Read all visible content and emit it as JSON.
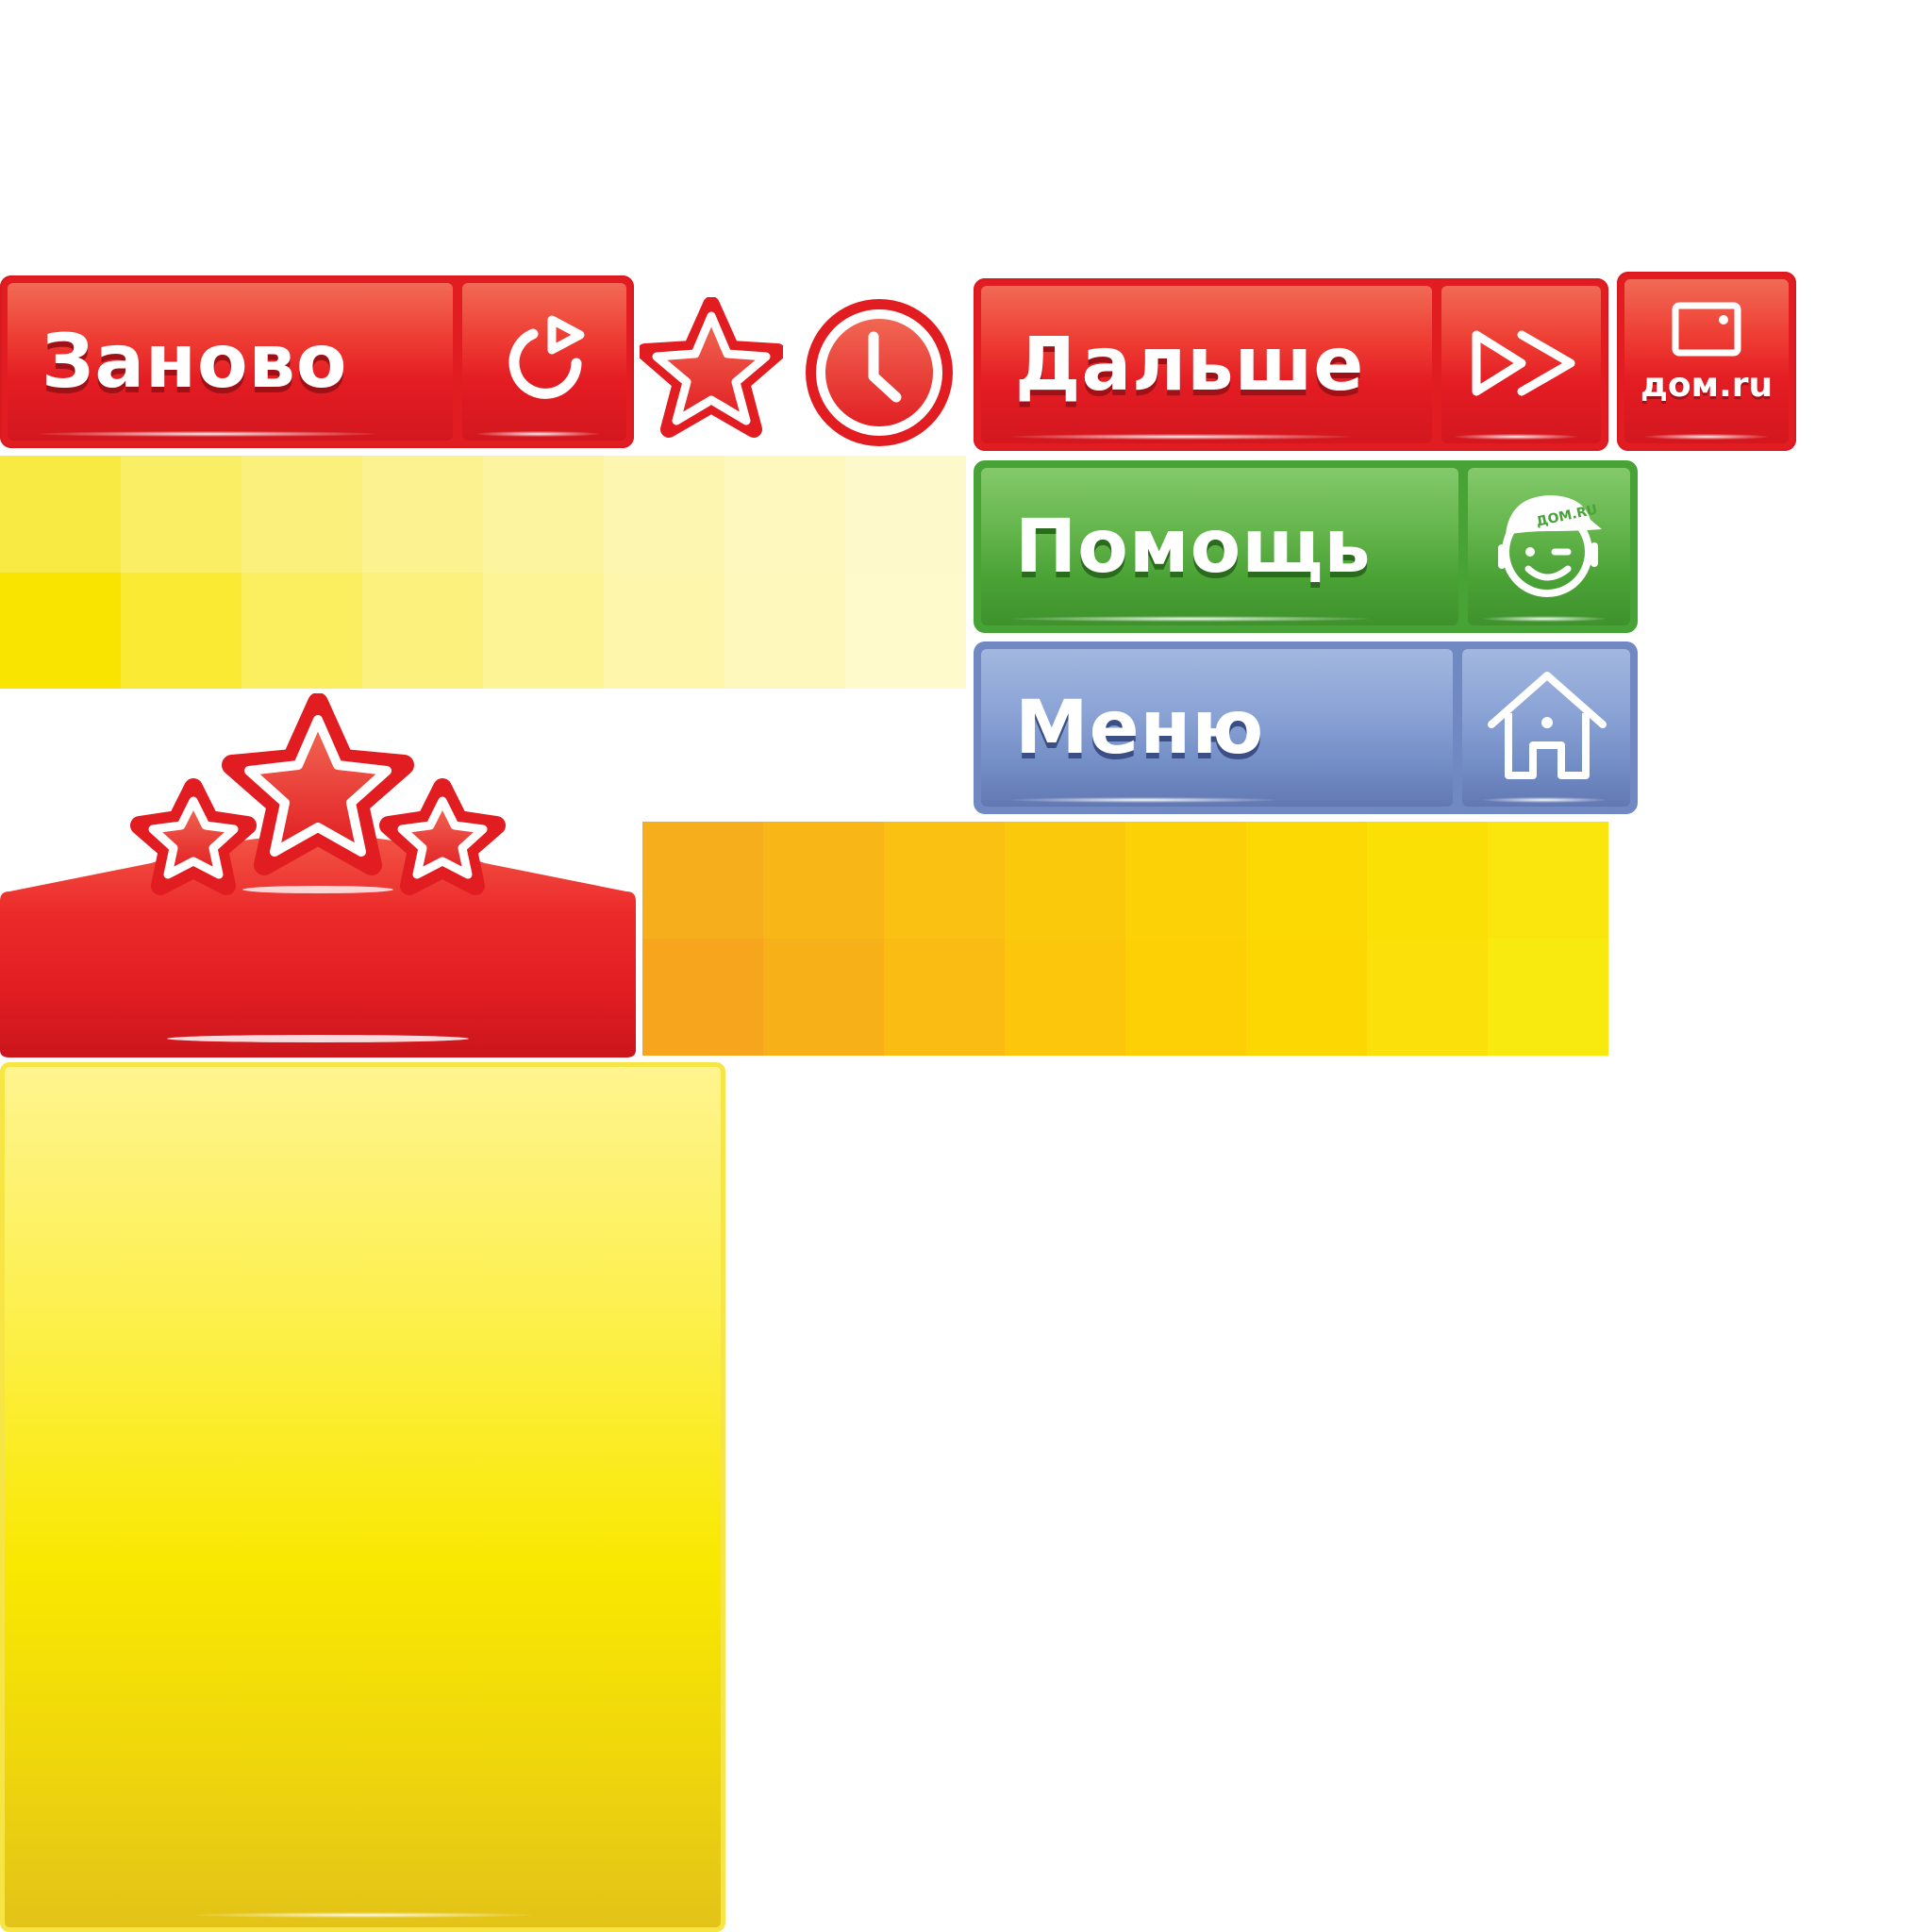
{
  "buttons": {
    "restart": {
      "label": "Заново",
      "icon": "restart-icon",
      "color": "#e11d22"
    },
    "next": {
      "label": "Дальше",
      "icon": "fast-forward-icon",
      "color": "#e11d22"
    },
    "help": {
      "label": "Помощь",
      "icon": "helper-face-icon",
      "color": "#48a337"
    },
    "menu": {
      "label": "Меню",
      "icon": "home-icon",
      "color": "#7189c2"
    }
  },
  "badges": {
    "star": {
      "icon": "star-icon"
    },
    "timer": {
      "icon": "clock-icon"
    }
  },
  "brand": {
    "logo_text": "дом.ru",
    "cap_text": "ДОМ.RU"
  },
  "palettes": {
    "light_yellow": [
      "#f9e400",
      "#faea33",
      "#fbee5f",
      "#fcf17d",
      "#fdf496",
      "#fdf6ab",
      "#fef8bd",
      "#fefacc"
    ],
    "orange_yellow": [
      "#f6a51c",
      "#f8b018",
      "#fabc12",
      "#fbc60c",
      "#fdd006",
      "#fcd702",
      "#fbe009",
      "#f8ea0e"
    ]
  },
  "header_panel": {
    "stars_icon": "three-stars-icon",
    "color": "#e11d22"
  },
  "panel": {
    "color": "#f9e800"
  }
}
